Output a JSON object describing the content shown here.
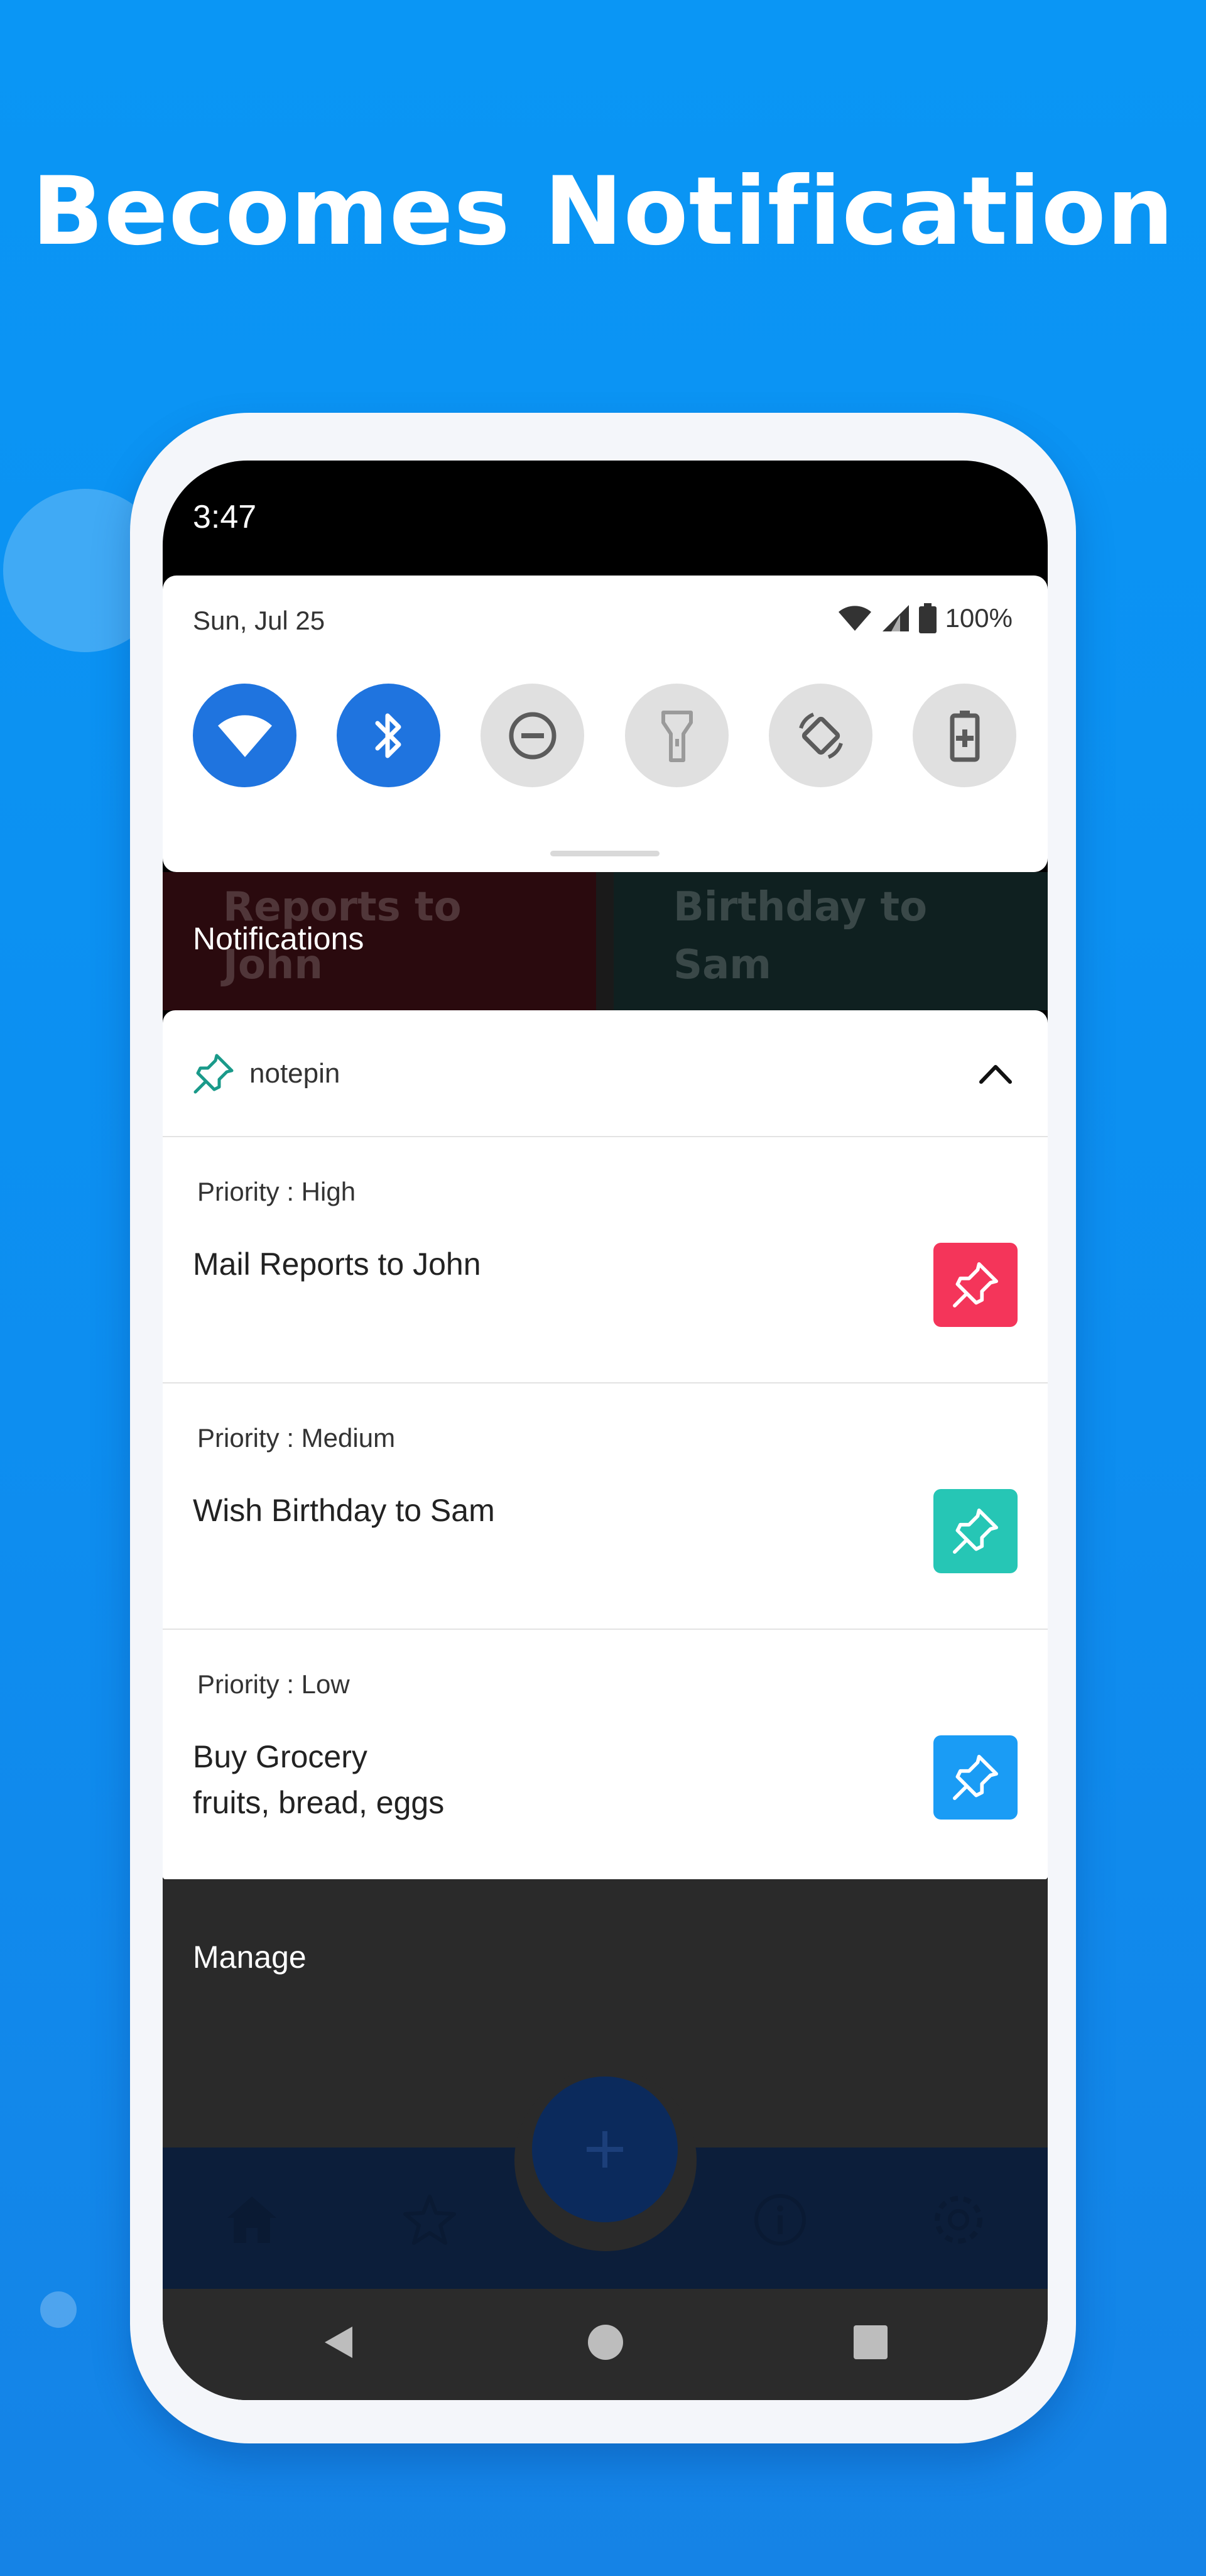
{
  "headline": "Becomes Notification",
  "status_bar": {
    "time": "3:47"
  },
  "quick_settings": {
    "date": "Sun, Jul 25",
    "battery": "100%",
    "tiles": [
      {
        "name": "wifi",
        "icon": "wifi-icon",
        "state": "on"
      },
      {
        "name": "bluetooth",
        "icon": "bluetooth-icon",
        "state": "on"
      },
      {
        "name": "do-not-disturb",
        "icon": "dnd-icon",
        "state": "off"
      },
      {
        "name": "flashlight",
        "icon": "flashlight-icon",
        "state": "off"
      },
      {
        "name": "auto-rotate",
        "icon": "rotate-icon",
        "state": "off"
      },
      {
        "name": "battery-saver",
        "icon": "battery-saver-icon",
        "state": "off"
      }
    ]
  },
  "background_cards": {
    "left": "Reports to\nJohn",
    "right": "Birthday to\nSam"
  },
  "notifications_label": "Notifications",
  "notification_group": {
    "app_name": "notepin",
    "items": [
      {
        "priority": "Priority : High",
        "title": "Mail Reports to John",
        "body": "",
        "pin_color": "#f4355a"
      },
      {
        "priority": "Priority : Medium",
        "title": "Wish Birthday to Sam",
        "body": "",
        "pin_color": "#26c6b5"
      },
      {
        "priority": "Priority : Low",
        "title": "Buy Grocery",
        "body": "fruits, bread, eggs",
        "pin_color": "#1a9cf5"
      }
    ]
  },
  "manage_label": "Manage",
  "bottom_nav": {
    "items": [
      "home-icon",
      "star-icon",
      "info-icon",
      "settings-icon"
    ],
    "fab_icon": "plus-icon"
  },
  "system_nav": [
    "back-icon",
    "home-circle-icon",
    "recents-icon"
  ],
  "colors": {
    "background": "#0d8ef0",
    "tile_on": "#1f74df",
    "tile_off": "#e0e0e0",
    "app_icon": "#1a9a8a"
  }
}
